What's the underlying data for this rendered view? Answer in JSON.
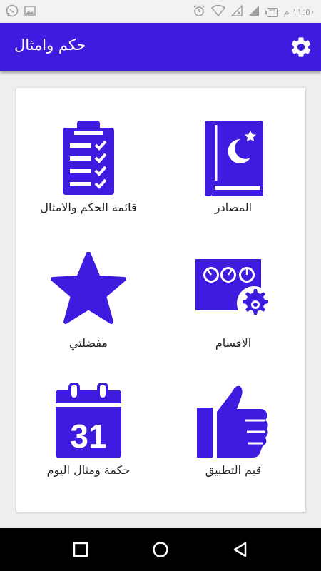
{
  "status_bar": {
    "time": "١١:٥٠ م",
    "battery": "٣٦",
    "colors": {
      "icon": "#9e9e9e"
    }
  },
  "app_bar": {
    "title": "حكم وامثال",
    "settings_icon": "gear-icon",
    "background": "#3f1be0"
  },
  "grid": {
    "accent": "#3f1be0",
    "tiles": [
      {
        "label": "المصادر",
        "icon": "book-icon"
      },
      {
        "label": "قائمة الحكم والامثال",
        "icon": "checklist-icon"
      },
      {
        "label": "الاقسام",
        "icon": "control-panel-gear-icon"
      },
      {
        "label": "مفضلتي",
        "icon": "star-icon"
      },
      {
        "label": "قيم التطبيق",
        "icon": "thumbs-up-icon"
      },
      {
        "label": "حكمة ومثال اليوم",
        "icon": "calendar-icon"
      }
    ],
    "calendar_day": "31"
  },
  "nav_bar": {
    "buttons": [
      "recents-icon",
      "home-icon",
      "back-icon"
    ]
  }
}
